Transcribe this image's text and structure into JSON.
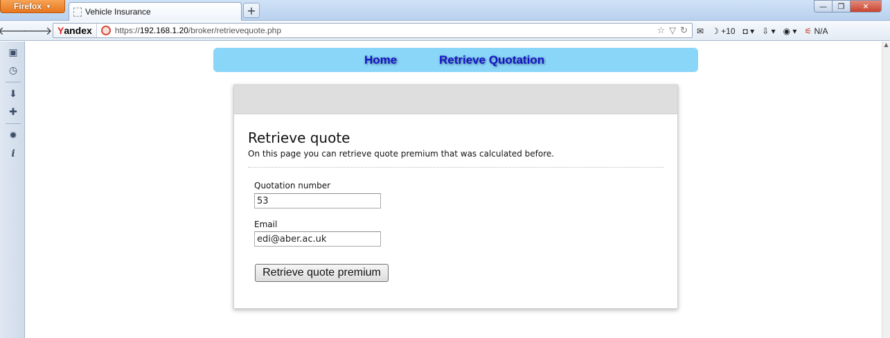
{
  "browser": {
    "menu_button": "Firefox",
    "tab_title": "Vehicle Insurance",
    "new_tab_symbol": "+",
    "window_controls": {
      "minimize": "—",
      "maximize": "❐",
      "close": "✕"
    }
  },
  "navbar": {
    "search_brand_prefix": "Y",
    "search_brand_rest": "andex",
    "url_scheme": "https://",
    "url_host": "192.168.1.20",
    "url_path": "/broker/retrievequote.php",
    "toolbar_counter": "+10",
    "toolbar_status": "N/A"
  },
  "site_menu": {
    "home": "Home",
    "retrieve": "Retrieve Quotation"
  },
  "page": {
    "title": "Retrieve quote",
    "description": "On this page you can retrieve quote premium that was calculated before.",
    "form": {
      "quotation_label": "Quotation number",
      "quotation_value": "53",
      "email_label": "Email",
      "email_value": "edi@aber.ac.uk",
      "submit_label": "Retrieve quote premium"
    }
  }
}
